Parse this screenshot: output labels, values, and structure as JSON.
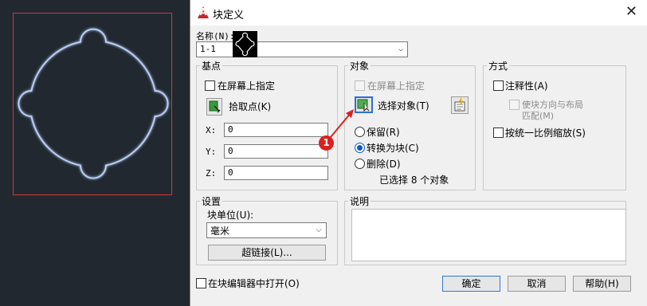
{
  "dialog": {
    "title": "块定义",
    "close_symbol": "✕",
    "name_label": "名称(N):",
    "name_value": "1-1"
  },
  "basepoint": {
    "group_title": "基点",
    "specify_onscreen": "在屏幕上指定",
    "pick_point": "拾取点(K)",
    "x_label": "X:",
    "x_value": "0",
    "y_label": "Y:",
    "y_value": "0",
    "z_label": "Z:",
    "z_value": "0"
  },
  "objects": {
    "group_title": "对象",
    "specify_onscreen": "在屏幕上指定",
    "select_objects": "选择对象(T)",
    "retain": "保留(R)",
    "convert_to_block": "转换为块(C)",
    "delete": "删除(D)",
    "selected_count": "已选择 8 个对象",
    "selected_option": "convert_to_block"
  },
  "behavior": {
    "group_title": "方式",
    "annotative": "注释性(A)",
    "match_orientation_line1": "使块方向与布局",
    "match_orientation_line2": "匹配(M)",
    "uniform_scale": "按统一比例缩放(S)"
  },
  "settings": {
    "group_title": "设置",
    "unit_label": "块单位(U):",
    "unit_value": "毫米",
    "hyperlink": "超链接(L)..."
  },
  "description": {
    "group_title": "说明",
    "value": ""
  },
  "footer": {
    "open_in_editor": "在块编辑器中打开(O)",
    "ok": "确定",
    "cancel": "取消",
    "help": "帮助(H)"
  },
  "annotation": {
    "callout_number": "1"
  },
  "colors": {
    "canvas_bg": "#212830",
    "shape_stroke": "#b9cdf5",
    "selection_frame": "#d33a3a",
    "callout": "#d9221f",
    "accent_blue": "#0a59c9"
  }
}
